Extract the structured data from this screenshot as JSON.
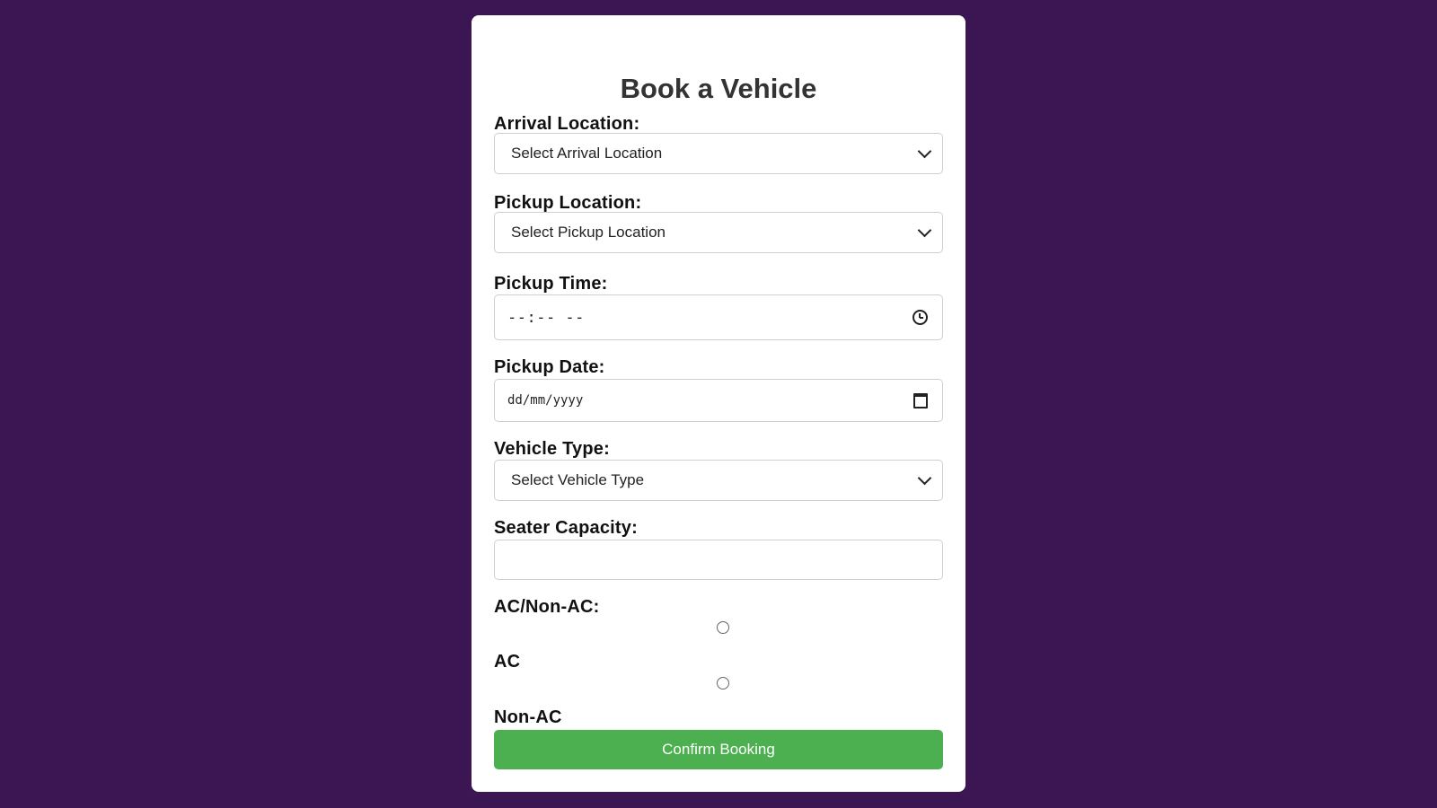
{
  "form": {
    "title": "Book a Vehicle",
    "arrival": {
      "label": "Arrival Location:",
      "value": "Select Arrival Location"
    },
    "pickup_location": {
      "label": "Pickup Location:",
      "value": "Select Pickup Location"
    },
    "pickup_time": {
      "label": "Pickup Time:",
      "value": "--:-- --"
    },
    "pickup_date": {
      "label": "Pickup Date:",
      "value": "dd/mm/yyyy"
    },
    "vehicle_type": {
      "label": "Vehicle Type:",
      "value": "Select Vehicle Type"
    },
    "seater_capacity": {
      "label": "Seater Capacity:",
      "value": ""
    },
    "ac": {
      "label": "AC/Non-AC:",
      "options": [
        {
          "label": "AC",
          "checked": false
        },
        {
          "label": "Non-AC",
          "checked": false
        }
      ]
    },
    "submit_label": "Confirm Booking"
  },
  "colors": {
    "background": "#3c1653",
    "card": "#ffffff",
    "button": "#4caf50"
  }
}
